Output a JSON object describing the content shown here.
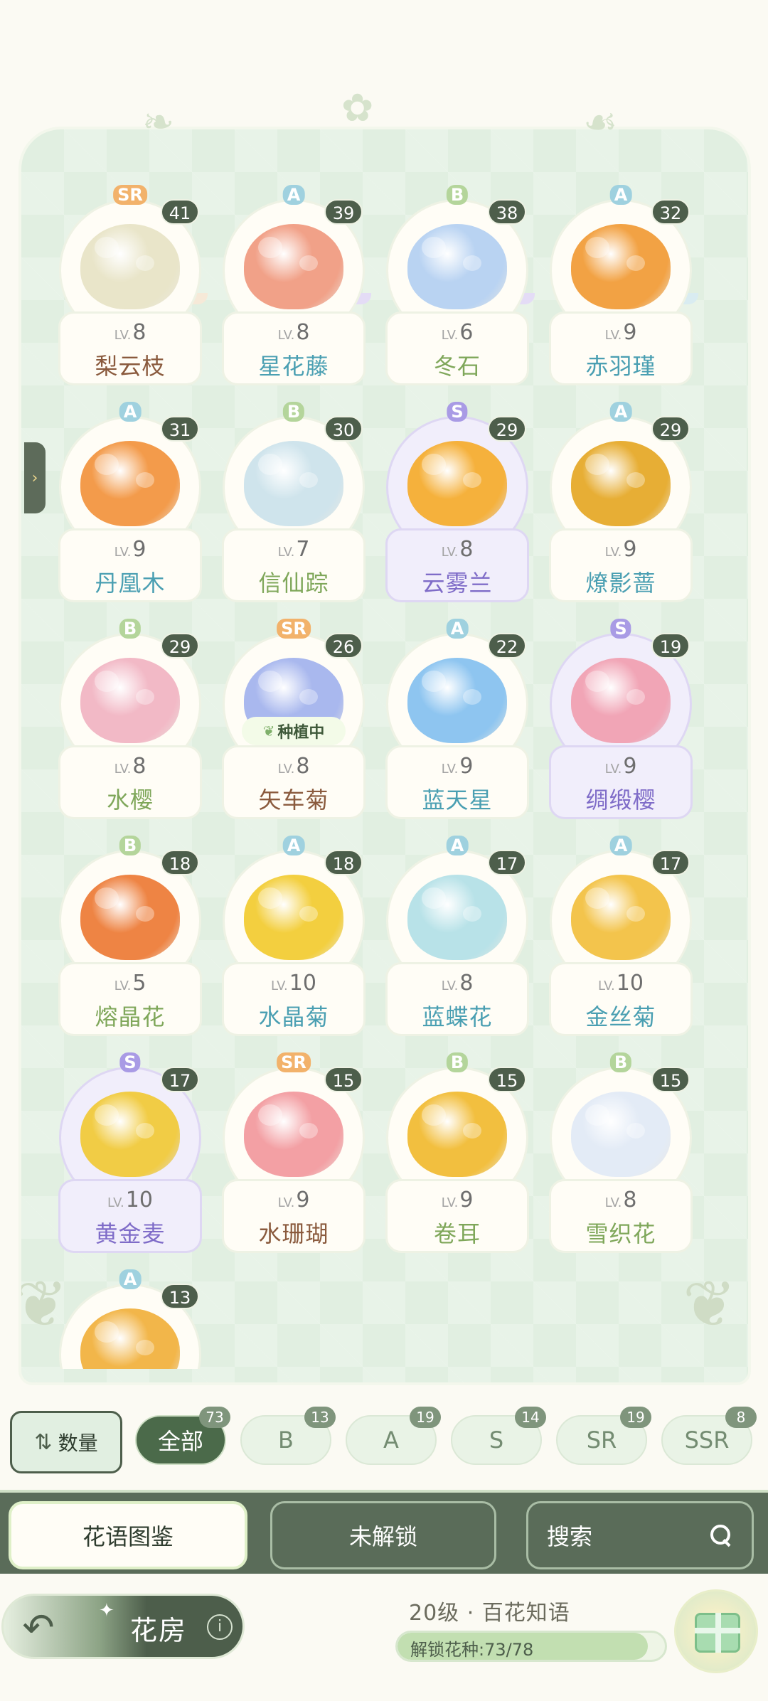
{
  "colors": {
    "panel_bg": "#e1efe1",
    "dark_green": "#4d5e4b",
    "rarity_A": "#9fd1df",
    "rarity_B": "#b4d59b",
    "rarity_S": "#a99be5",
    "rarity_SR": "#f2b26b"
  },
  "flowers": [
    {
      "rarity": "SR",
      "count": "41",
      "level": "8",
      "name": "梨云枝",
      "color": "#e9e5c9",
      "icon": "lily-basket-icon"
    },
    {
      "rarity": "A",
      "count": "39",
      "level": "8",
      "name": "星花藤",
      "color": "#f1a188",
      "icon": "heart-vine-icon"
    },
    {
      "rarity": "B",
      "count": "38",
      "level": "6",
      "name": "冬石",
      "color": "#b9d3f2",
      "icon": "crystal-ball-icon"
    },
    {
      "rarity": "A",
      "count": "32",
      "level": "9",
      "name": "赤羽瑾",
      "color": "#f2a244",
      "icon": "feather-flower-icon"
    },
    {
      "rarity": "A",
      "count": "31",
      "level": "9",
      "name": "丹凰木",
      "color": "#f39b4b",
      "icon": "maple-tree-icon"
    },
    {
      "rarity": "B",
      "count": "30",
      "level": "7",
      "name": "信仙踪",
      "color": "#cfe4ec",
      "icon": "white-bouquet-icon"
    },
    {
      "rarity": "S",
      "count": "29",
      "level": "8",
      "name": "云雾兰",
      "color": "#f5b13c",
      "icon": "orange-orchid-icon"
    },
    {
      "rarity": "A",
      "count": "29",
      "level": "9",
      "name": "燎影蔷",
      "color": "#e7ae35",
      "icon": "rose-bush-icon"
    },
    {
      "rarity": "B",
      "count": "29",
      "level": "8",
      "name": "水樱",
      "color": "#f2b9c6",
      "icon": "cherry-tree-icon"
    },
    {
      "rarity": "SR",
      "count": "26",
      "level": "8",
      "name": "矢车菊",
      "color": "#a9b8ee",
      "icon": "cornflower-icon",
      "status": "种植中"
    },
    {
      "rarity": "A",
      "count": "22",
      "level": "9",
      "name": "蓝天星",
      "color": "#8ec5f0",
      "icon": "star-flower-icon"
    },
    {
      "rarity": "S",
      "count": "19",
      "level": "9",
      "name": "绸缎樱",
      "color": "#f1a5b6",
      "icon": "satin-cherry-icon"
    },
    {
      "rarity": "B",
      "count": "18",
      "level": "5",
      "name": "熔晶花",
      "color": "#ee8444",
      "icon": "lava-flower-icon"
    },
    {
      "rarity": "A",
      "count": "18",
      "level": "10",
      "name": "水晶菊",
      "color": "#f3cf3f",
      "icon": "crystal-mum-icon"
    },
    {
      "rarity": "A",
      "count": "17",
      "level": "8",
      "name": "蓝蝶花",
      "color": "#b8e2e8",
      "icon": "butterfly-flower-icon"
    },
    {
      "rarity": "A",
      "count": "17",
      "level": "10",
      "name": "金丝菊",
      "color": "#f3c44c",
      "icon": "gold-mum-icon"
    },
    {
      "rarity": "S",
      "count": "17",
      "level": "10",
      "name": "黄金麦",
      "color": "#f1cc45",
      "icon": "golden-wheat-icon"
    },
    {
      "rarity": "SR",
      "count": "15",
      "level": "9",
      "name": "水珊瑚",
      "color": "#f3a0a4",
      "icon": "coral-flower-icon"
    },
    {
      "rarity": "B",
      "count": "15",
      "level": "9",
      "name": "卷耳",
      "color": "#f2bf3f",
      "icon": "curled-ear-icon"
    },
    {
      "rarity": "B",
      "count": "15",
      "level": "8",
      "name": "雪织花",
      "color": "#e3ebf6",
      "icon": "snow-lily-icon"
    },
    {
      "rarity": "A",
      "count": "13",
      "level": "",
      "name": "",
      "color": "#f2b64a",
      "icon": "marigold-icon"
    }
  ],
  "lv_prefix": "LV.",
  "sort": {
    "label": "数量",
    "icon": "sort-arrows-icon"
  },
  "filters": [
    {
      "label": "全部",
      "count": "73",
      "active": true
    },
    {
      "label": "B",
      "count": "13"
    },
    {
      "label": "A",
      "count": "19"
    },
    {
      "label": "S",
      "count": "14"
    },
    {
      "label": "SR",
      "count": "19"
    },
    {
      "label": "SSR",
      "count": "8"
    }
  ],
  "nav": {
    "catalog": "花语图鉴",
    "locked": "未解锁",
    "search": "搜索"
  },
  "footer": {
    "back_label": "花房",
    "level_title": "20级 · 百花知语",
    "progress_label": "解锁花种:73/78",
    "progress_fraction": 0.936
  }
}
